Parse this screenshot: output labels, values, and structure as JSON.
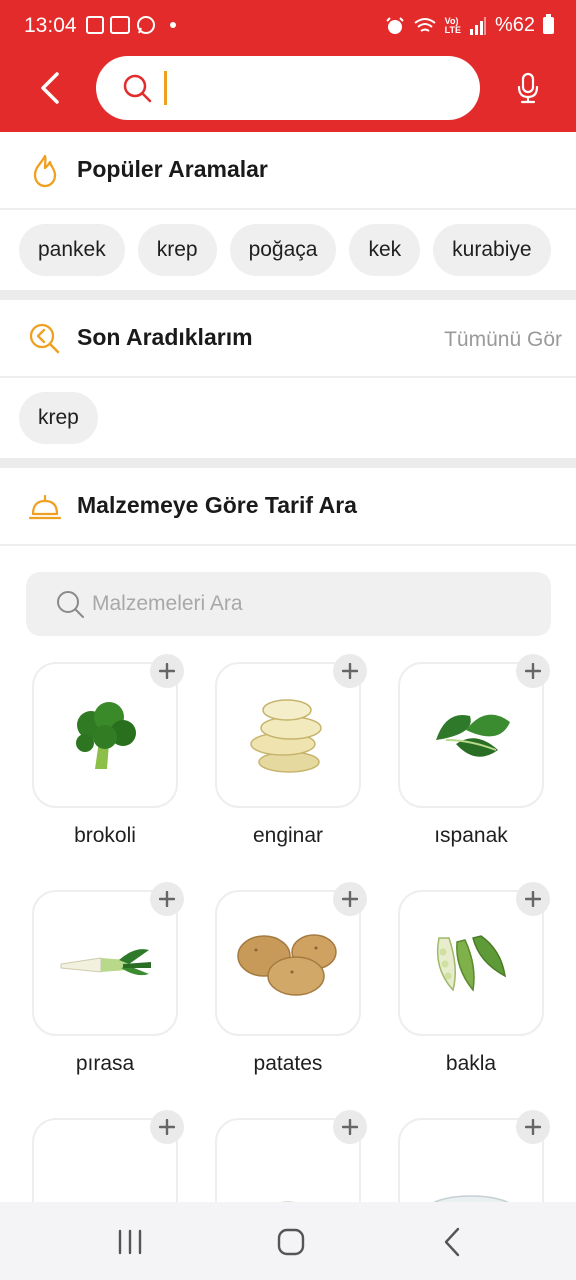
{
  "status_bar": {
    "time": "13:04",
    "battery": "%62",
    "icons": [
      "gallery-icon",
      "ge-icon",
      "whatsapp-icon",
      "notification-dot-icon",
      "alarm-icon",
      "wifi-calling-icon",
      "volte-icon",
      "signal-icon",
      "battery-icon"
    ],
    "volte_text": "Vo)\nLTE"
  },
  "header": {
    "search_value": "",
    "accent_color": "#e32b2b"
  },
  "popular": {
    "title": "Popüler Aramalar",
    "chips": [
      "pankek",
      "krep",
      "poğaça",
      "kek",
      "kurabiye"
    ]
  },
  "recent": {
    "title": "Son Aradıklarım",
    "see_all": "Tümünü Gör",
    "chips": [
      "krep"
    ]
  },
  "ingredients": {
    "title": "Malzemeye Göre Tarif Ara",
    "search_placeholder": "Malzemeleri Ara",
    "items": [
      {
        "name": "brokoli",
        "icon": "broccoli-icon"
      },
      {
        "name": "enginar",
        "icon": "artichoke-icon"
      },
      {
        "name": "ıspanak",
        "icon": "spinach-icon"
      },
      {
        "name": "pırasa",
        "icon": "leek-icon"
      },
      {
        "name": "patates",
        "icon": "potato-icon"
      },
      {
        "name": "bakla",
        "icon": "broad-bean-icon"
      },
      {
        "name": "",
        "icon": "salt-icon"
      },
      {
        "name": "",
        "icon": "flour-icon"
      },
      {
        "name": "",
        "icon": "oil-icon"
      }
    ]
  },
  "nav": {
    "buttons": [
      "recents-icon",
      "home-icon",
      "back-icon"
    ]
  }
}
